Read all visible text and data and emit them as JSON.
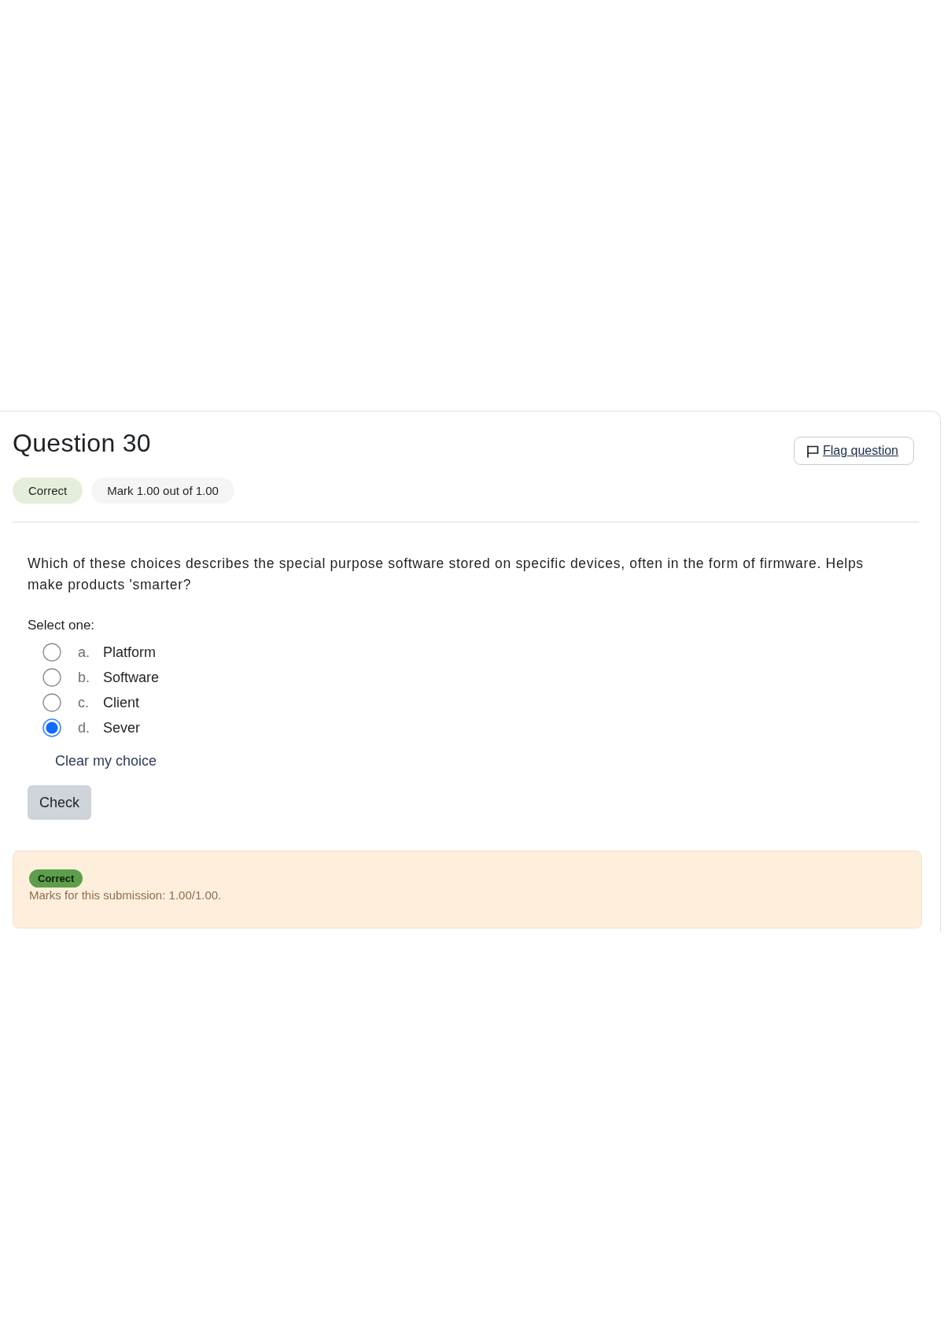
{
  "question": {
    "title": "Question 30",
    "flag_button": "Flag question",
    "state_badge": "Correct",
    "mark_badge": "Mark 1.00 out of 1.00"
  },
  "prompt": "Which of these choices describes the special purpose software stored on specific devices, often in the form of firmware. Helps make products 'smarter?",
  "answer": {
    "instruction": "Select one:",
    "options": [
      {
        "letter": "a.",
        "label": "Platform",
        "selected": false
      },
      {
        "letter": "b.",
        "label": "Software",
        "selected": false
      },
      {
        "letter": "c.",
        "label": "Client",
        "selected": false
      },
      {
        "letter": "d.",
        "label": "Sever",
        "selected": true
      }
    ],
    "clear_link": "Clear my choice"
  },
  "check_button": "Check",
  "feedback": {
    "badge": "Correct",
    "marks": "Marks for this submission: 1.00/1.00."
  }
}
